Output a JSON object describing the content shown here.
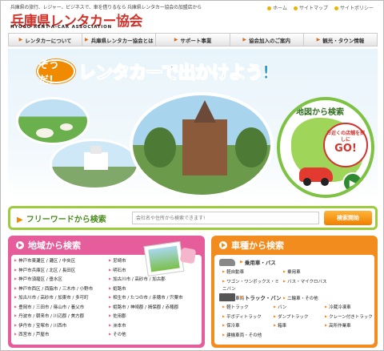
{
  "header": {
    "tagline": "兵庫県の旅行、レジャー、ビジネスで、車を借りるなら 兵庫県レンタカー協会の加盟店から",
    "logo": "兵庫県レンタカー協会",
    "logo_sub": "HYOGO RENT-A-CAR ASSOCIATION",
    "toplinks": [
      "ホーム",
      "サイトマップ",
      "サイトポリシー"
    ]
  },
  "nav": {
    "items": [
      "レンタカーについて",
      "兵庫県レンタカー協会とは",
      "サポート事業",
      "協会加入のご案内",
      "観光・タウン情報"
    ]
  },
  "hero": {
    "soudha": "そうだ!",
    "catch": "レンタカーで出かけよう!",
    "map_title": "地図から検索",
    "map_bubble": "お近くの店舗を探しに",
    "map_go": "GO!"
  },
  "search": {
    "label": "フリーワードから検索",
    "placeholder": "会社名や住所から検索できます!",
    "button": "検索開始"
  },
  "area_panel": {
    "title": "地域から検索",
    "col1": [
      "神戸市東灘区 / 灘区 / 中央区",
      "神戸市兵庫区 / 北区 / 長田区",
      "神戸市須磨区 / 垂水区",
      "神戸市西区 / 西脇市 / 三木市 / 小野市",
      "加古川市 / 高砂市 / 加東市 / 多可町",
      "豊岡市 / 三田市 / 篠山市 / 養父市",
      "丹波市 / 朝来市 / 川辺郡 / 美方郡",
      "伊丹市 / 宝塚市 / 川西市",
      "西宮市 / 芦屋市"
    ],
    "col2": [
      "尼崎市",
      "明石市",
      "加古川市 / 高砂市 / 加古郡",
      "姫路市",
      "相生市 / たつの市 / 赤穂市 / 宍粟市",
      "姫路市 / 神崎郡 / 揖保郡 / 赤穂郡",
      "佐用郡",
      "洲本市",
      "その他"
    ]
  },
  "type_panel": {
    "title": "車種から検索",
    "car_label": "乗用車・バス",
    "car_items": [
      "軽自動車",
      "乗用車",
      "ワゴン・ワンボックス・ミニバン",
      "バス・マイクロバス",
      "福祉車両",
      "二輪車・その他"
    ],
    "truck_label": "トラック・バン",
    "truck_items": [
      "軽トラック",
      "バン",
      "冷蔵冷凍車",
      "平ボディトラック",
      "ダンプトラック",
      "クレーン付きトラック",
      "保冷車",
      "箱車",
      "高所作業車",
      "建機車両・その他"
    ]
  },
  "colors": {
    "accent_red": "#d0342c",
    "area_pink": "#e65d9b",
    "type_orange": "#f28c1e",
    "search_green": "#9ccc3c",
    "catch_blue": "#2a9ad8"
  }
}
